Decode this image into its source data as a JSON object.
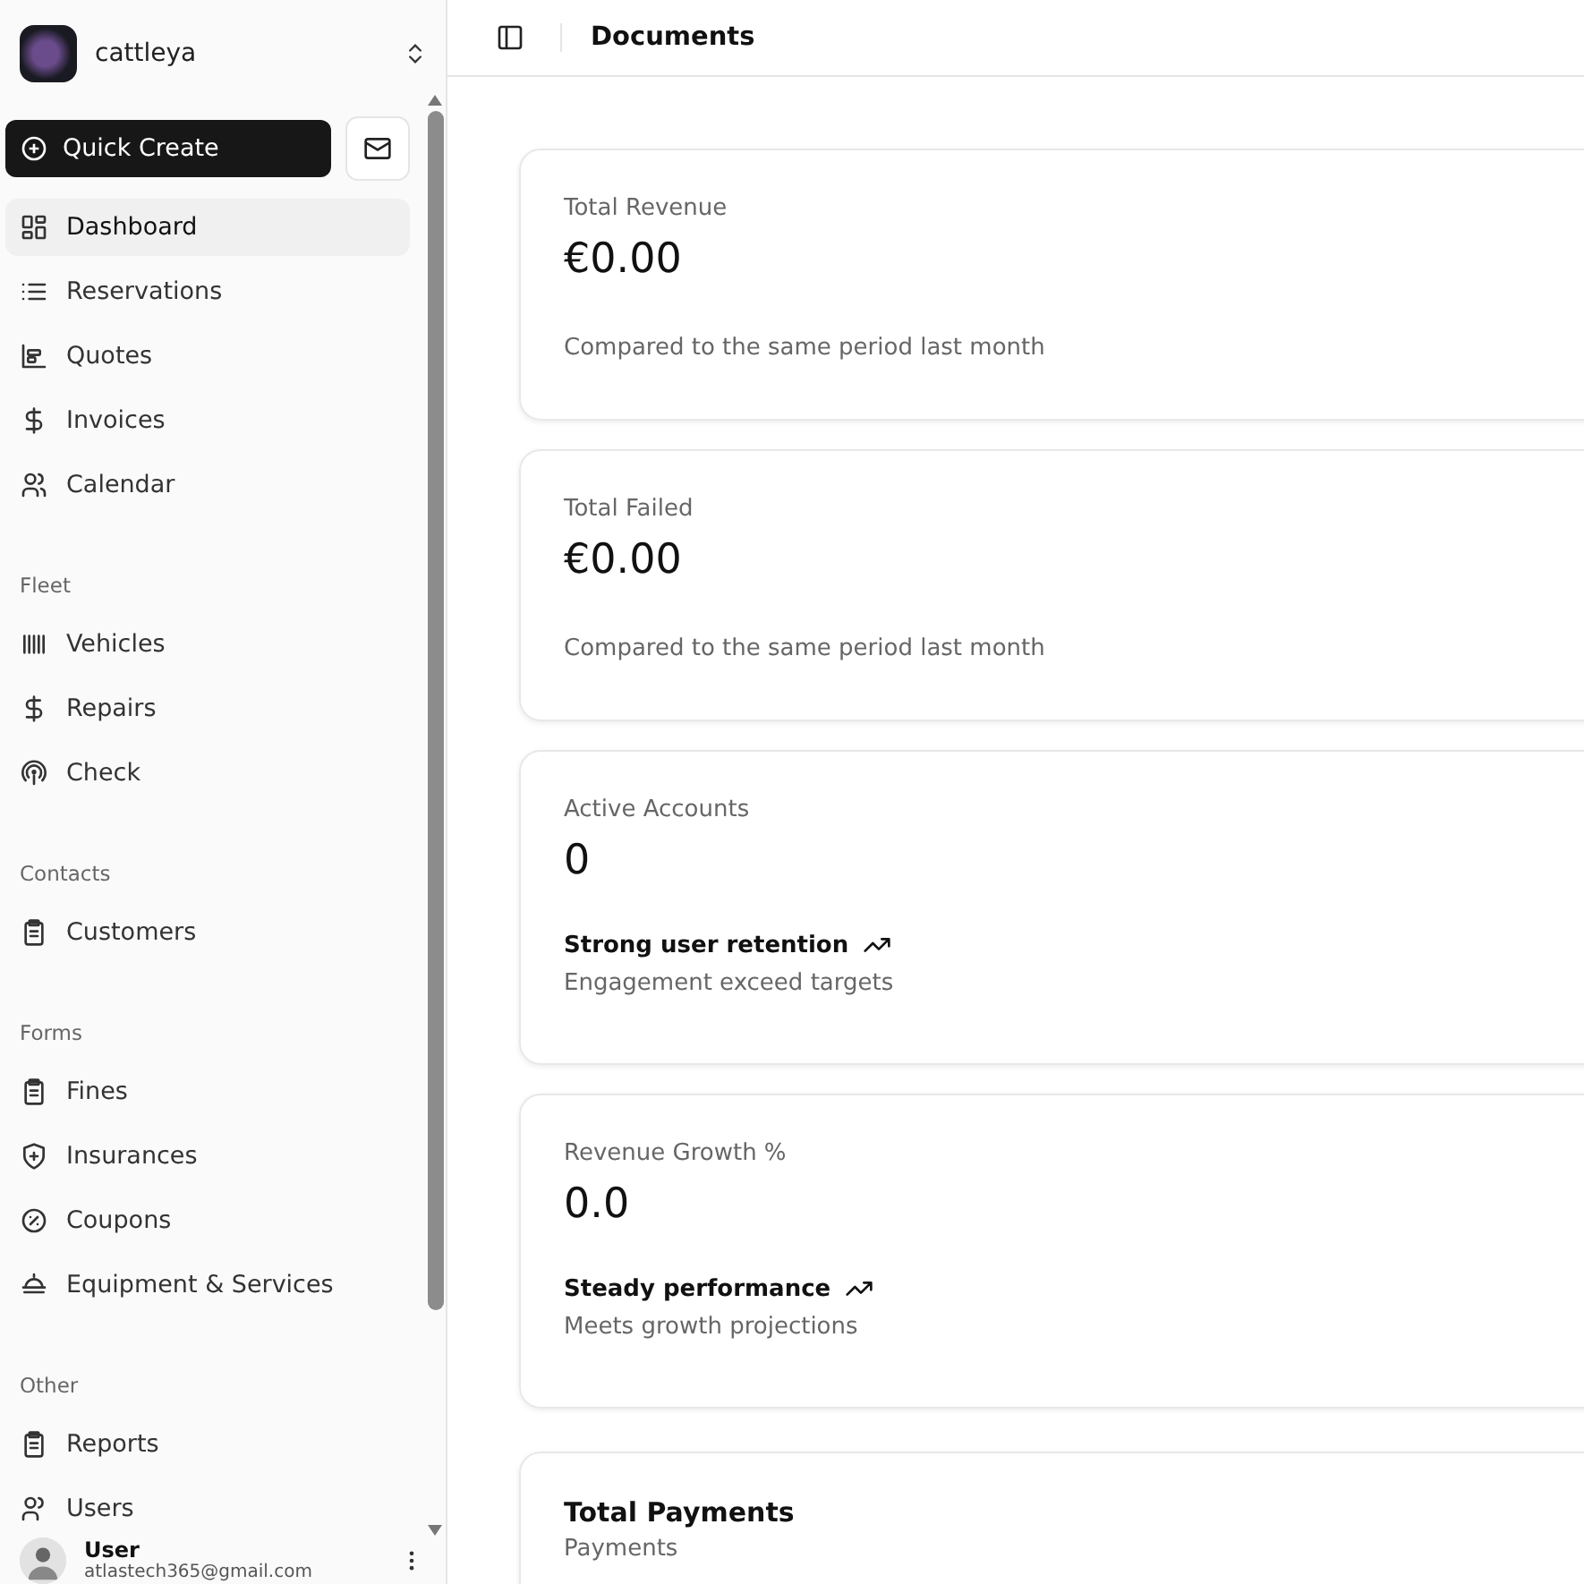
{
  "workspace": {
    "name": "cattleya"
  },
  "quick_create": {
    "label": "Quick Create"
  },
  "sidebar": {
    "sections": [
      {
        "items": [
          {
            "label": "Dashboard",
            "selected": true
          },
          {
            "label": "Reservations",
            "selected": false
          },
          {
            "label": "Quotes",
            "selected": false
          },
          {
            "label": "Invoices",
            "selected": false
          },
          {
            "label": "Calendar",
            "selected": false
          }
        ]
      },
      {
        "title": "Fleet",
        "items": [
          {
            "label": "Vehicles",
            "selected": false
          },
          {
            "label": "Repairs",
            "selected": false
          },
          {
            "label": "Check",
            "selected": false
          }
        ]
      },
      {
        "title": "Contacts",
        "items": [
          {
            "label": "Customers",
            "selected": false
          }
        ]
      },
      {
        "title": "Forms",
        "items": [
          {
            "label": "Fines",
            "selected": false
          },
          {
            "label": "Insurances",
            "selected": false
          },
          {
            "label": "Coupons",
            "selected": false
          },
          {
            "label": "Equipment & Services",
            "selected": false
          }
        ]
      },
      {
        "title": "Other",
        "items": [
          {
            "label": "Reports",
            "selected": false
          },
          {
            "label": "Users",
            "selected": false
          }
        ]
      }
    ]
  },
  "user": {
    "name": "User",
    "email": "atlastech365@gmail.com"
  },
  "header": {
    "title": "Documents"
  },
  "cards": [
    {
      "kind": "stat",
      "title": "Total Revenue",
      "value": "€0.00",
      "description": "Compared to the same period last month"
    },
    {
      "kind": "stat",
      "title": "Total Failed",
      "value": "€0.00",
      "description": "Compared to the same period last month"
    },
    {
      "kind": "trend",
      "title": "Active Accounts",
      "value": "0",
      "trend": "Strong user retention",
      "description": "Engagement exceed targets"
    },
    {
      "kind": "trend",
      "title": "Revenue Growth %",
      "value": "0.0",
      "trend": "Steady performance",
      "description": "Meets growth projections"
    },
    {
      "kind": "payments",
      "title": "Total Payments",
      "description": "Payments"
    }
  ]
}
